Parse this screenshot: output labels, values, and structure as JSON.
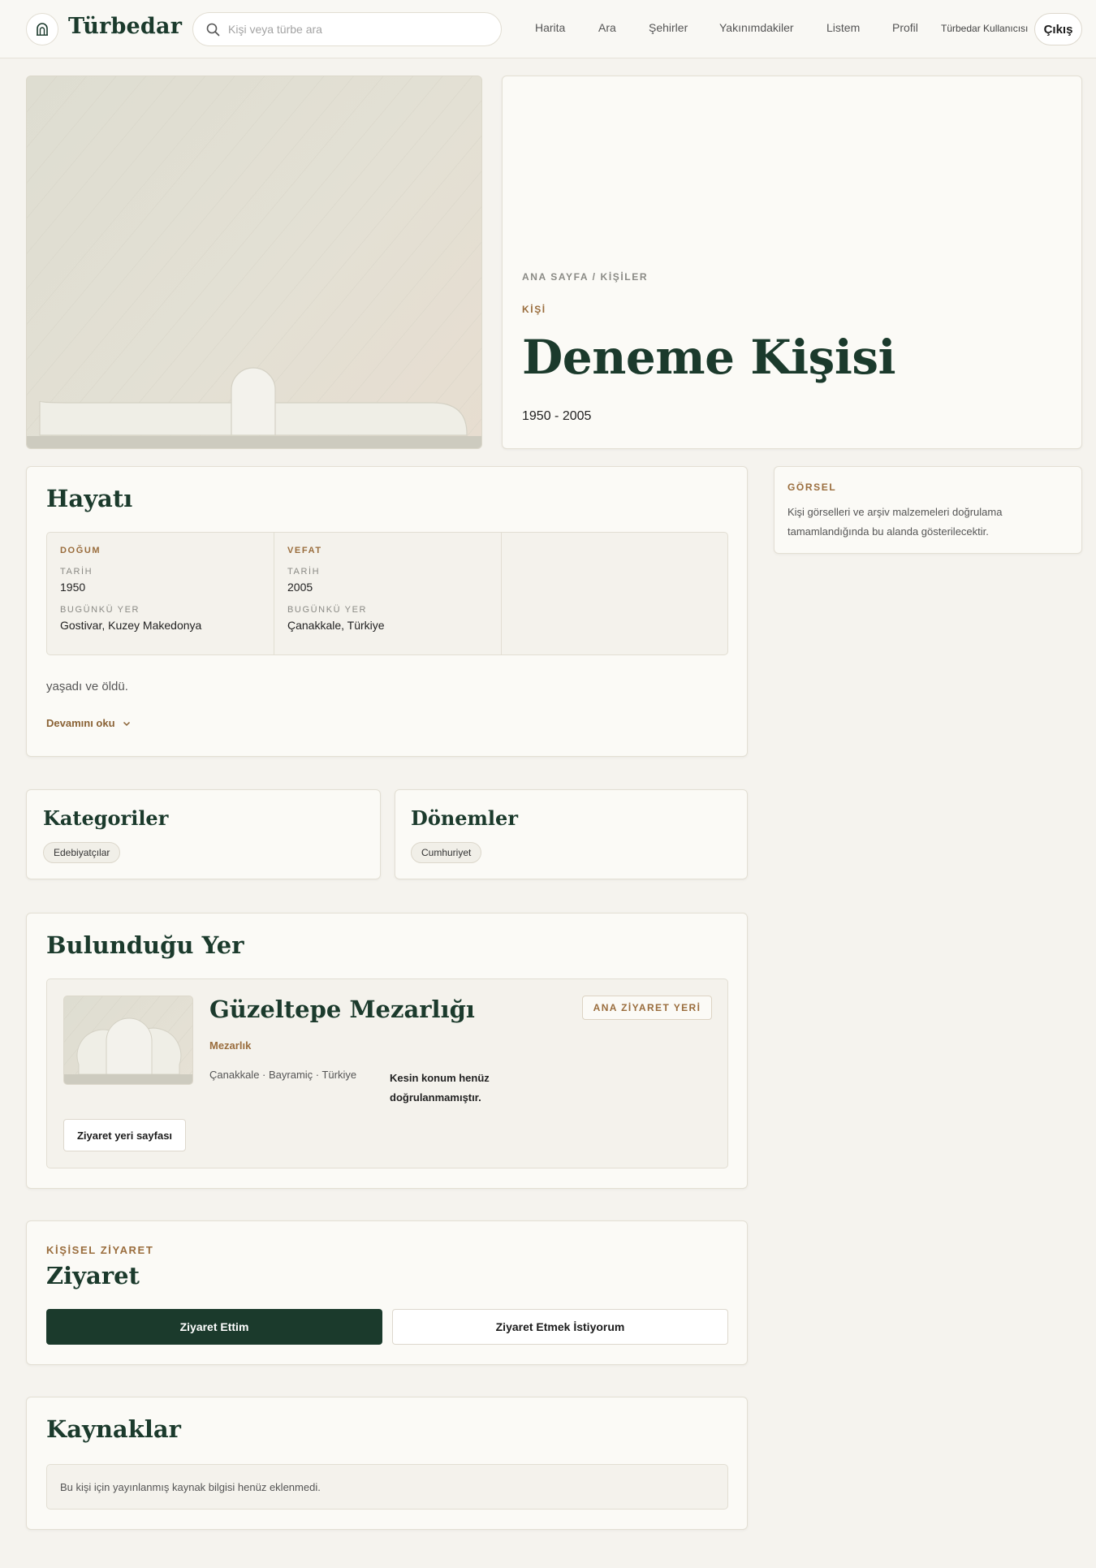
{
  "header": {
    "brand": "Türbedar",
    "search_placeholder": "Kişi veya türbe ara",
    "nav": [
      "Harita",
      "Ara",
      "Şehirler",
      "Yakınımdakiler",
      "Listem",
      "Profil"
    ],
    "user_name": "Türbedar Kullanıcısı",
    "logout_label": "Çıkış"
  },
  "hero": {
    "breadcrumb": "ANA SAYFA / KİŞİLER",
    "type_label": "KİŞİ",
    "name": "Deneme Kişisi",
    "years": "1950 - 2005"
  },
  "visual_note": {
    "heading": "GÖRSEL",
    "text": "Kişi görselleri ve arşiv malzemeleri doğrulama tamamlandığında bu alanda gösterilecektir."
  },
  "life": {
    "title": "Hayatı",
    "birth": {
      "heading": "DOĞUM",
      "date_label": "TARİH",
      "date": "1950",
      "place_label": "BUGÜNKÜ YER",
      "place": "Gostivar, Kuzey Makedonya"
    },
    "death": {
      "heading": "VEFAT",
      "date_label": "TARİH",
      "date": "2005",
      "place_label": "BUGÜNKÜ YER",
      "place": "Çanakkale, Türkiye"
    },
    "summary": "yaşadı ve öldü.",
    "read_more": "Devamını oku"
  },
  "categories": {
    "title": "Kategoriler",
    "tags": [
      "Edebiyatçılar"
    ]
  },
  "periods": {
    "title": "Dönemler",
    "tags": [
      "Cumhuriyet"
    ]
  },
  "location": {
    "title": "Bulunduğu Yer",
    "place_name": "Güzeltepe Mezarlığı",
    "place_type": "Mezarlık",
    "badge": "ANA ZİYARET YERİ",
    "address": "Çanakkale · Bayramiç · Türkiye",
    "note": "Kesin konum henüz doğrulanmamıştır.",
    "page_button": "Ziyaret yeri sayfası"
  },
  "visit": {
    "eyebrow": "KİŞİSEL ZİYARET",
    "title": "Ziyaret",
    "visited_button": "Ziyaret Ettim",
    "want_button": "Ziyaret Etmek İstiyorum"
  },
  "sources": {
    "title": "Kaynaklar",
    "empty_text": "Bu kişi için yayınlanmış kaynak bilgisi henüz eklenmedi."
  },
  "colors": {
    "brand": "#1b3a2c",
    "accent": "#9a6d3d",
    "background": "#f5f3ee",
    "card": "#fbfaf6"
  },
  "icons": {
    "logo": "tomb-arch-icon",
    "search": "search-icon",
    "read_more": "chevron-down-icon"
  }
}
